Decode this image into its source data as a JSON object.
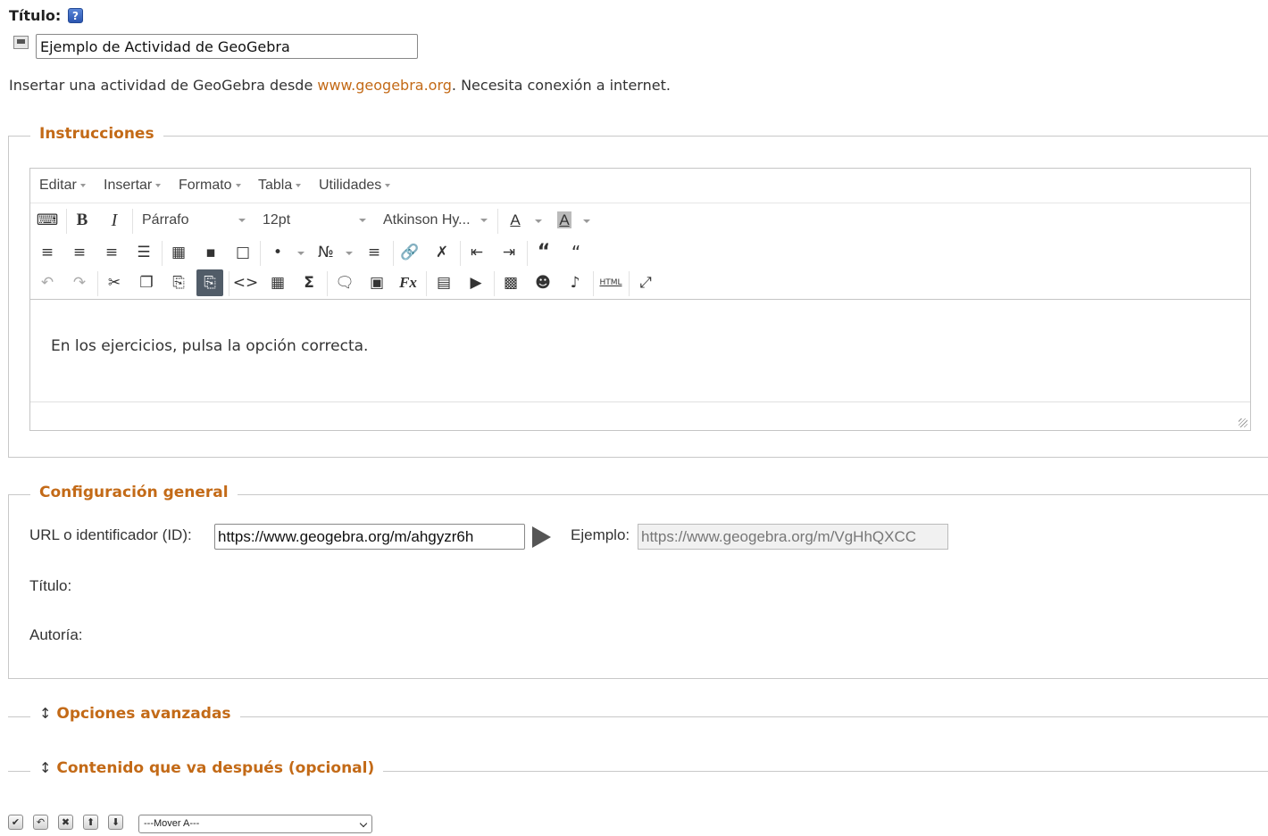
{
  "header": {
    "title_label": "Título:",
    "help_icon": "question-icon",
    "title_value": "Ejemplo de Actividad de GeoGebra"
  },
  "intro": {
    "before_link": "Insertar una actividad de GeoGebra desde ",
    "link": "www.geogebra.org",
    "after_link": ". Necesita conexión a internet."
  },
  "instructions": {
    "legend": "Instrucciones",
    "menus": [
      "Editar",
      "Insertar",
      "Formato",
      "Tabla",
      "Utilidades"
    ],
    "block_format": "Párrafo",
    "font_size": "12pt",
    "font_family": "Atkinson Hy...",
    "content": "En los ejercicios, pulsa la opción correcta."
  },
  "config": {
    "legend": "Configuración general",
    "url_label": "URL o identificador (ID):",
    "url_value": "https://www.geogebra.org/m/ahgyzr6h",
    "example_label": "Ejemplo:",
    "example_value": "https://www.geogebra.org/m/VgHhQXCC",
    "title_label": "Título:",
    "author_label": "Autoría:"
  },
  "advanced": {
    "legend": "Opciones avanzadas"
  },
  "after": {
    "legend": "Contenido que va después (opcional)"
  },
  "footer": {
    "move_select": "---Mover A---"
  },
  "colors": {
    "accent": "#c36a17",
    "active_button": "#515c68"
  }
}
